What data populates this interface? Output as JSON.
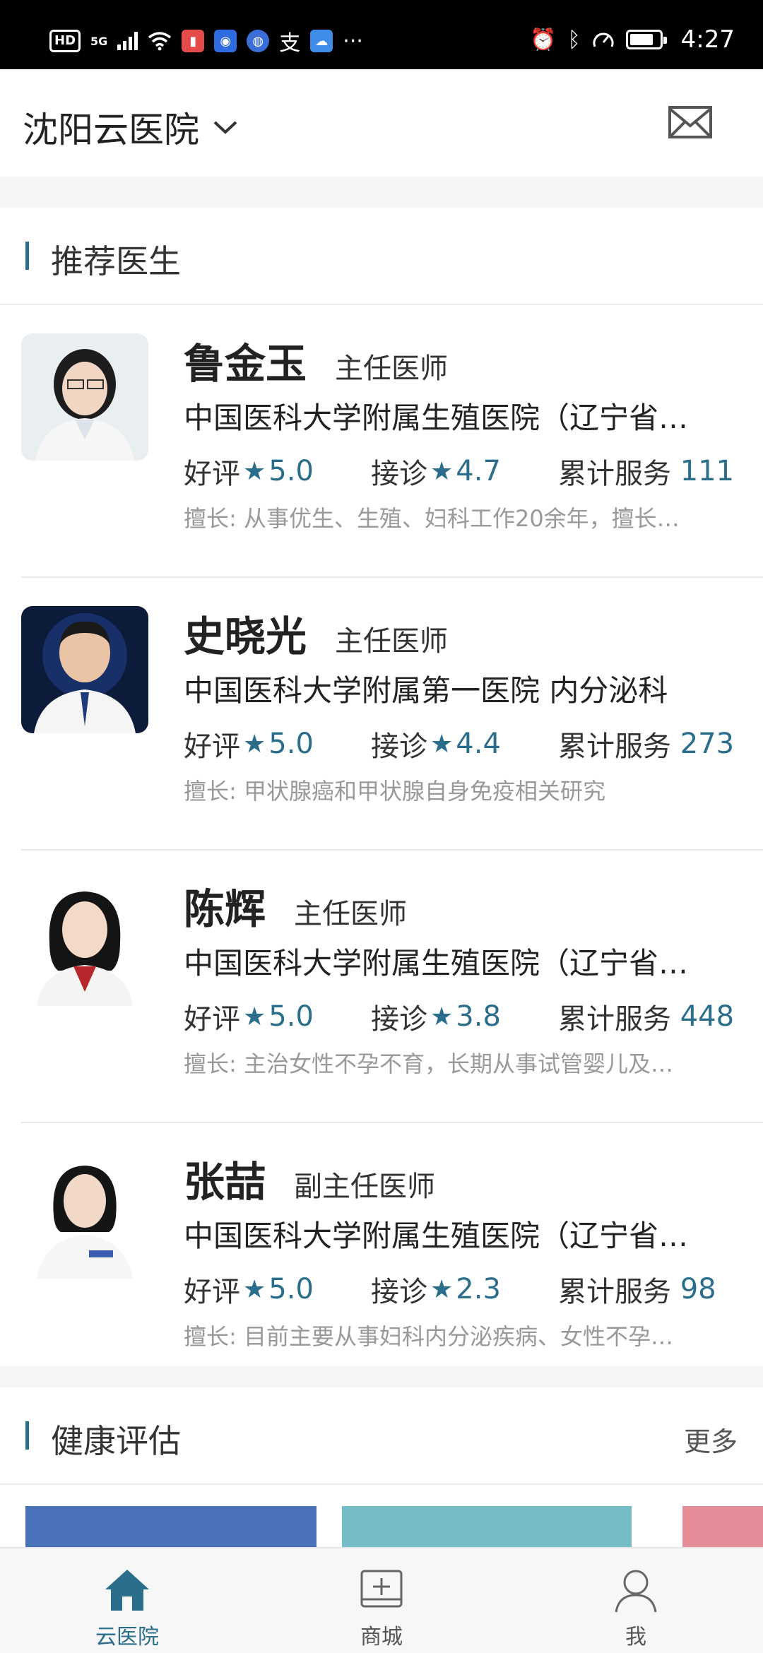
{
  "status_bar": {
    "left_text": "HD",
    "network": "5G",
    "app_glyph": "支",
    "more": "···",
    "time": "4:27"
  },
  "header": {
    "hospital_name": "沈阳云医院",
    "mail_icon": "mail-icon"
  },
  "recommended": {
    "title": "推荐医生",
    "doctors": [
      {
        "name": "鲁金玉",
        "title": "主任医师",
        "hospital": "中国医科大学附属生殖医院（辽宁省…",
        "rating_label": "好评",
        "rating": "5.0",
        "consult_label": "接诊",
        "consult": "4.7",
        "served_label": "累计服务",
        "served": "111",
        "specialty": "擅长: 从事优生、生殖、妇科工作20余年，擅长…"
      },
      {
        "name": "史晓光",
        "title": "主任医师",
        "hospital": "中国医科大学附属第一医院  内分泌科",
        "rating_label": "好评",
        "rating": "5.0",
        "consult_label": "接诊",
        "consult": "4.4",
        "served_label": "累计服务",
        "served": "273",
        "specialty": "擅长: 甲状腺癌和甲状腺自身免疫相关研究"
      },
      {
        "name": "陈辉",
        "title": "主任医师",
        "hospital": "中国医科大学附属生殖医院（辽宁省…",
        "rating_label": "好评",
        "rating": "5.0",
        "consult_label": "接诊",
        "consult": "3.8",
        "served_label": "累计服务",
        "served": "448",
        "specialty": "擅长: 主治女性不孕不育，长期从事试管婴儿及…"
      },
      {
        "name": "张喆",
        "title": "副主任医师",
        "hospital": "中国医科大学附属生殖医院（辽宁省…",
        "rating_label": "好评",
        "rating": "5.0",
        "consult_label": "接诊",
        "consult": "2.3",
        "served_label": "累计服务",
        "served": "98",
        "specialty": "擅长: 目前主要从事妇科内分泌疾病、女性不孕…"
      }
    ]
  },
  "health": {
    "title": "健康评估",
    "more": "更多"
  },
  "bottom_nav": [
    {
      "label": "云医院",
      "icon": "home-icon",
      "active": true
    },
    {
      "label": "商城",
      "icon": "store-icon",
      "active": false
    },
    {
      "label": "我",
      "icon": "user-icon",
      "active": false
    }
  ],
  "colors": {
    "accent": "#2b6e8c"
  }
}
